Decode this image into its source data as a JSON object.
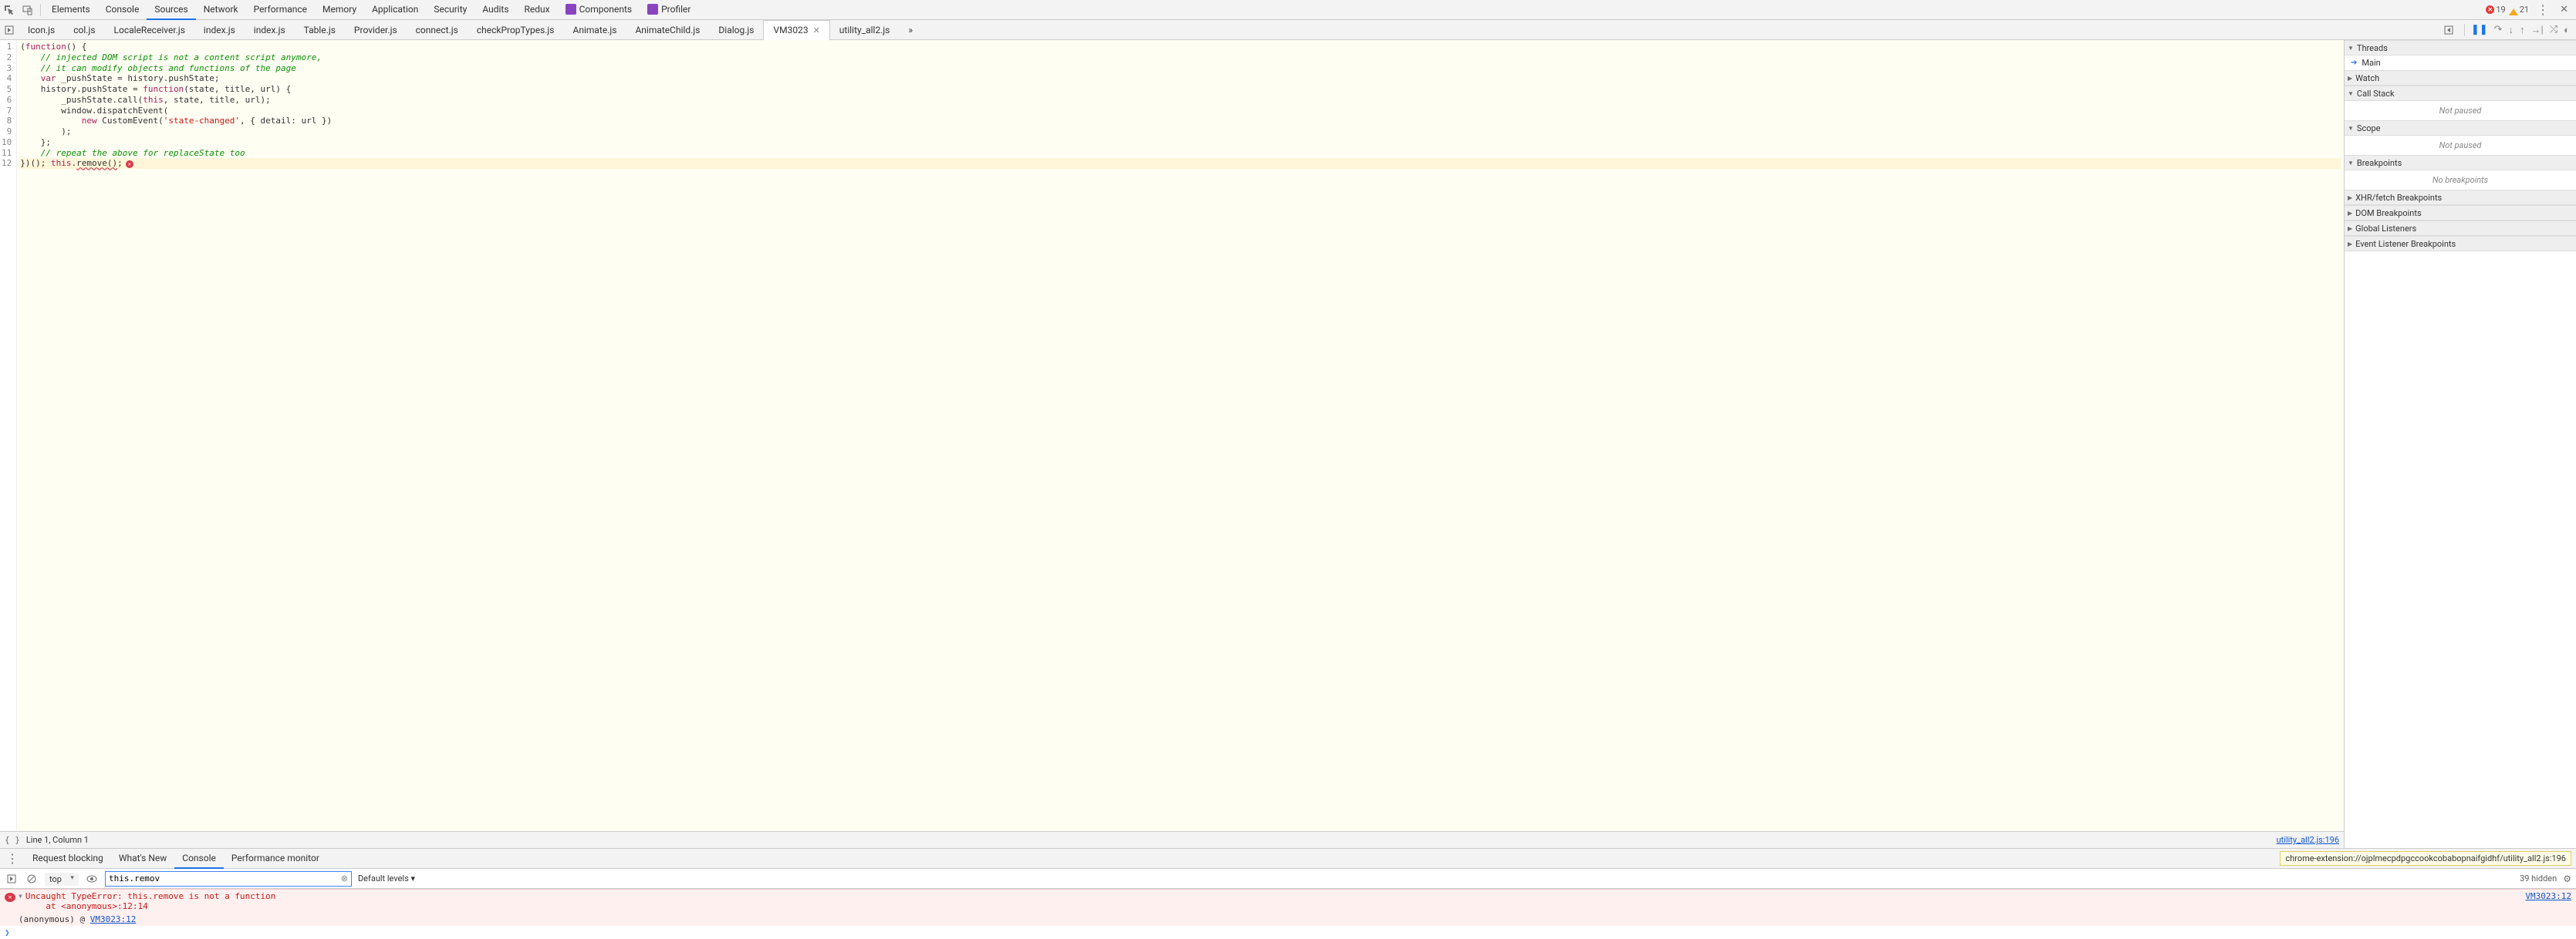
{
  "top_panels": [
    "Elements",
    "Console",
    "Sources",
    "Network",
    "Performance",
    "Memory",
    "Application",
    "Security",
    "Audits",
    "Redux"
  ],
  "top_panels_active": "Sources",
  "ext_panels": [
    {
      "label": "Components"
    },
    {
      "label": "Profiler"
    }
  ],
  "error_count": "19",
  "warn_count": "21",
  "file_tabs": [
    "Icon.js",
    "col.js",
    "LocaleReceiver.js",
    "index.js",
    "index.js",
    "Table.js",
    "Provider.js",
    "connect.js",
    "checkPropTypes.js",
    "Animate.js",
    "AnimateChild.js",
    "Dialog.js",
    "VM3023",
    "utility_all2.js"
  ],
  "file_tab_active": "VM3023",
  "overflow_glyph": "»",
  "code_lines": [
    "(function() {",
    "    // injected DOM script is not a content script anymore,",
    "    // it can modify objects and functions of the page",
    "    var _pushState = history.pushState;",
    "    history.pushState = function(state, title, url) {",
    "        _pushState.call(this, state, title, url);",
    "        window.dispatchEvent(",
    "            new CustomEvent('state-changed', { detail: url })",
    "        );",
    "    };",
    "    // repeat the above for replaceState too",
    "})(); this.remove();"
  ],
  "error_line_index": 11,
  "line_col": "Line 1, Column 1",
  "source_link": "utility_all2.js:196",
  "debug": {
    "threads": {
      "title": "Threads",
      "item": "Main"
    },
    "watch": {
      "title": "Watch"
    },
    "callstack": {
      "title": "Call Stack",
      "msg": "Not paused"
    },
    "scope": {
      "title": "Scope",
      "msg": "Not paused"
    },
    "breakpoints": {
      "title": "Breakpoints",
      "msg": "No breakpoints"
    },
    "xhr": {
      "title": "XHR/fetch Breakpoints"
    },
    "dom": {
      "title": "DOM Breakpoints"
    },
    "global": {
      "title": "Global Listeners"
    },
    "event": {
      "title": "Event Listener Breakpoints"
    }
  },
  "drawer_tabs": [
    "Request blocking",
    "What's New",
    "Console",
    "Performance monitor"
  ],
  "drawer_tab_active": "Console",
  "drawer_url": "chrome-extension://ojplmecpdpgccookcobabopnaifgidhf/utility_all2.js:196",
  "console": {
    "context": "top",
    "filter_value": "this.remov",
    "levels": "Default levels ▾",
    "hidden": "39 hidden",
    "error_text": "Uncaught TypeError: this.remove is not a function\n    at <anonymous>:12:14",
    "error_src": "VM3023:12",
    "trace_label": "(anonymous) @ ",
    "trace_link": "VM3023:12"
  }
}
